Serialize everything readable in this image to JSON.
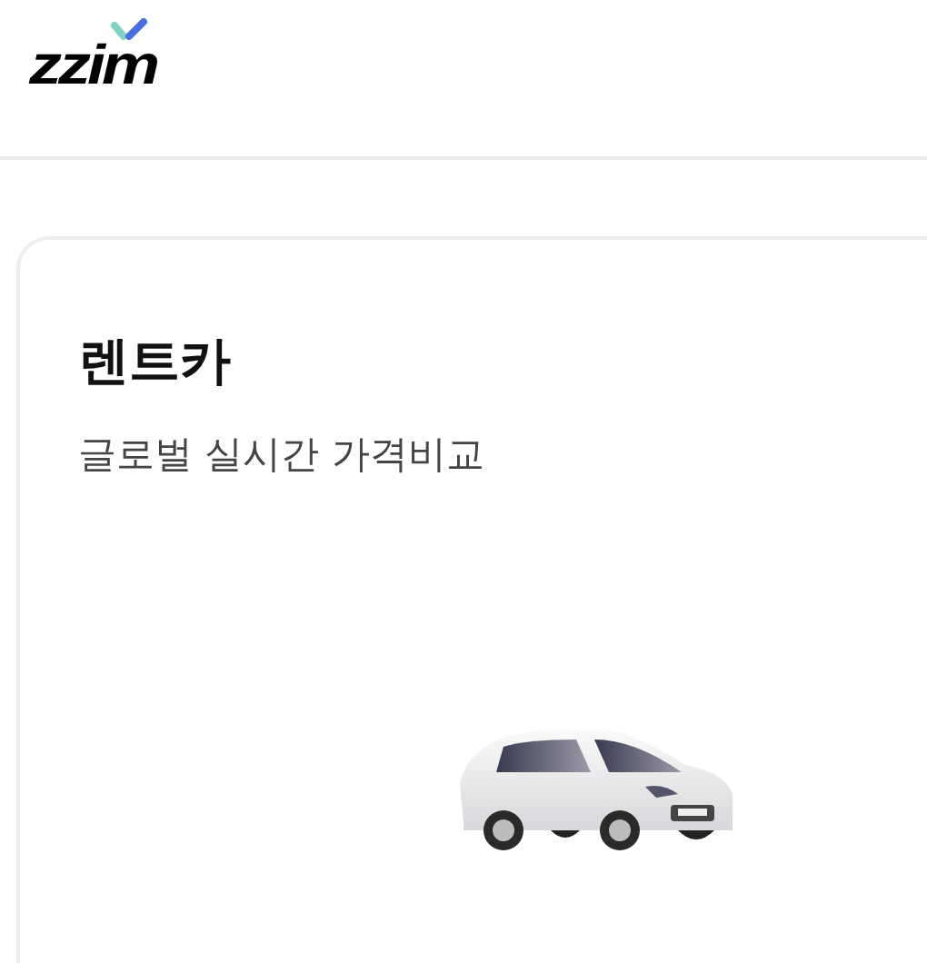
{
  "header": {
    "logo": "zzim"
  },
  "card": {
    "title": "렌트카",
    "subtitle": "글로벌 실시간 가격비교",
    "image": {
      "kind": "car"
    }
  }
}
